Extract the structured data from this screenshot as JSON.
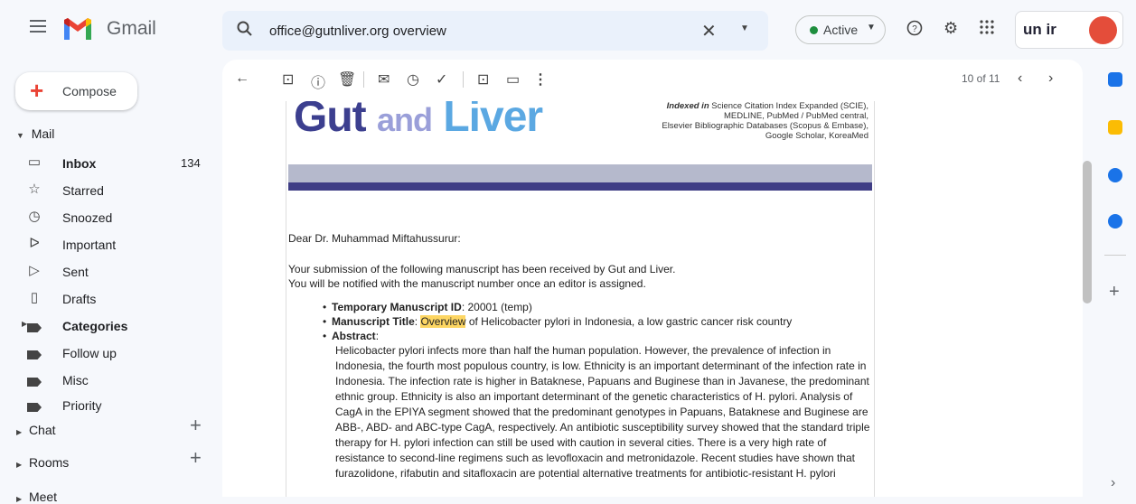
{
  "topbar": {
    "app_name": "Gmail",
    "search_query": "office@gutnliver.org overview",
    "status": "Active",
    "org_logo_text": "un ir"
  },
  "sidebar": {
    "compose": "Compose",
    "mail_section": "Mail",
    "items": [
      {
        "icon": "inbox-icon",
        "label": "Inbox",
        "count": "134",
        "bold": true
      },
      {
        "icon": "star-icon",
        "label": "Starred",
        "count": ""
      },
      {
        "icon": "clock-icon",
        "label": "Snoozed",
        "count": ""
      },
      {
        "icon": "important-icon",
        "label": "Important",
        "count": ""
      },
      {
        "icon": "send-icon",
        "label": "Sent",
        "count": ""
      },
      {
        "icon": "draft-icon",
        "label": "Drafts",
        "count": ""
      },
      {
        "icon": "label-icon",
        "label": "Categories",
        "count": "",
        "bold": true
      },
      {
        "icon": "label-icon",
        "label": "Follow up",
        "count": ""
      },
      {
        "icon": "label-icon",
        "label": "Misc",
        "count": ""
      },
      {
        "icon": "label-icon",
        "label": "Priority",
        "count": ""
      }
    ],
    "chat": "Chat",
    "rooms": "Rooms",
    "meet": "Meet"
  },
  "pager": "10 of 11",
  "email": {
    "journal_gut": "Gut",
    "journal_and": "and",
    "journal_liver": "Liver",
    "indexed_bold": "Indexed in",
    "indexed_line1": "Science Citation Index Expanded (SCIE),",
    "indexed_line2": "MEDLINE, PubMed / PubMed central,",
    "indexed_line3": "Elsevier Bibliographic Databases (Scopus & Embase),",
    "indexed_line4": "Google Scholar, KoreaMed",
    "greeting": "Dear Dr. Muhammad Miftahussurur:",
    "line1": "Your submission of the following manuscript has been received by Gut and Liver.",
    "line2": "You will be notified with the manuscript number once an editor is assigned.",
    "id_label": "Temporary Manuscript ID",
    "id_value": ": 20001 (temp)",
    "title_label": "Manuscript Title",
    "title_colon": ": ",
    "title_highlight": "Overview",
    "title_rest": " of Helicobacter pylori in Indonesia, a low gastric cancer risk country",
    "abstract_label": "Abstract",
    "abstract_colon": ":",
    "abstract_text": "Helicobacter pylori infects more than half the human population. However, the prevalence of infection in Indonesia, the fourth most populous country, is low. Ethnicity is an important determinant of the infection rate in Indonesia. The infection rate is higher in Bataknese, Papuans and Buginese than in Javanese, the predominant ethnic group. Ethnicity is also an important determinant of the genetic characteristics of H. pylori. Analysis of CagA in the EPIYA segment showed that the predominant genotypes in Papuans, Bataknese and Buginese are ABB-, ABD- and ABC-type CagA, respectively. An antibiotic susceptibility survey showed that the standard triple therapy for H. pylori infection can still be used with caution in several cities. There is a very high rate of resistance to second-line regimens such as levofloxacin and metronidazole. Recent studies have shown that furazolidone, rifabutin and sitafloxacin are potential alternative treatments for antibiotic-resistant H. pylori"
  }
}
